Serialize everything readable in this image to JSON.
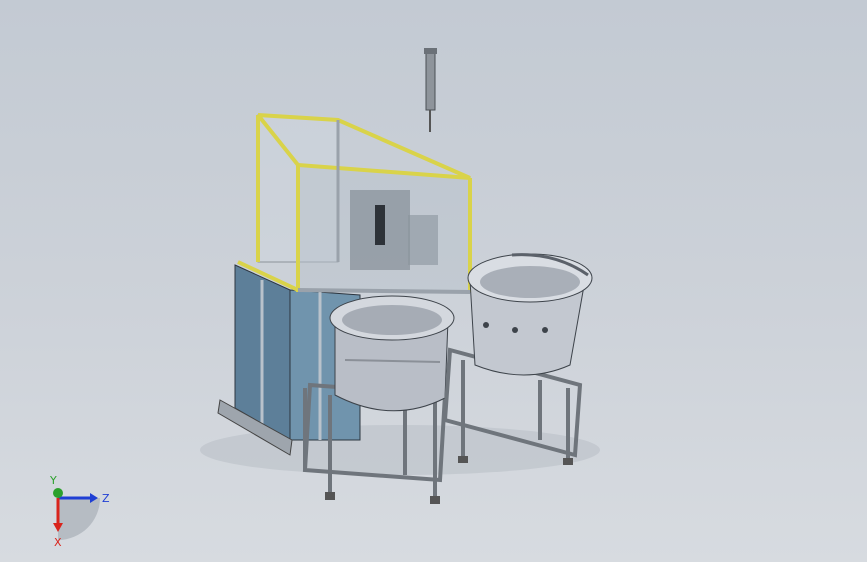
{
  "viewport": {
    "background_top": "#c3cad3",
    "background_bottom": "#d7dbe0"
  },
  "colors": {
    "frame_yellow": "#d9d34a",
    "frame_grey": "#9aa2ab",
    "panel_blue": "#6f8ea7",
    "bowl_grey": "#c8ccd4",
    "stand_grey": "#a9aeb6",
    "axis_x": "#d9241c",
    "axis_y": "#2ca02c",
    "axis_z": "#1f3fd4"
  },
  "triad": {
    "x_label": "X",
    "y_label": "Y",
    "z_label": "Z"
  },
  "icons": [
    "coordinate-triad-icon"
  ]
}
